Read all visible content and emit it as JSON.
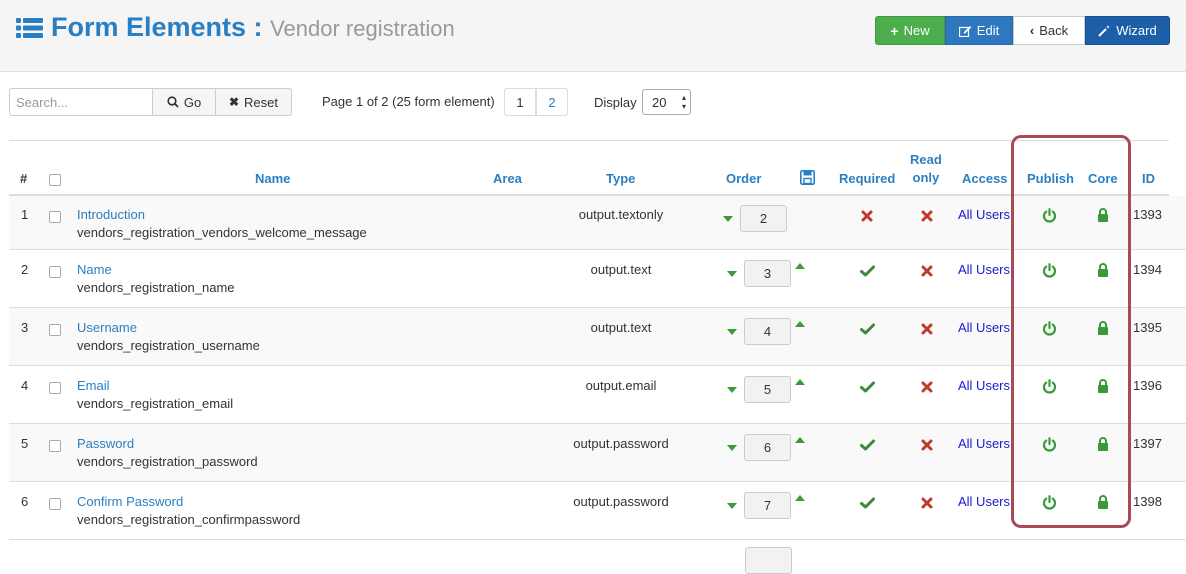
{
  "header": {
    "title": "Form Elements :",
    "subtitle": "Vendor registration",
    "icon": "list-icon"
  },
  "toolbar": {
    "new_label": "New",
    "edit_label": "Edit",
    "back_label": "Back",
    "wizard_label": "Wizard"
  },
  "filter": {
    "search_placeholder": "Search...",
    "go_label": "Go",
    "reset_label": "Reset",
    "page_info": "Page 1 of 2 (25 form element)",
    "pages": [
      "1",
      "2"
    ],
    "display_label": "Display",
    "display_value": "20"
  },
  "columns": {
    "hash": "#",
    "name": "Name",
    "area": "Area",
    "type": "Type",
    "order": "Order",
    "required": "Required",
    "read_only_1": "Read",
    "read_only_2": "only",
    "access": "Access",
    "publish": "Publish",
    "core": "Core",
    "id": "ID"
  },
  "rows": [
    {
      "num": "1",
      "label": "Introduction",
      "name": "vendors_registration_vendors_welcome_message",
      "type": "output.textonly",
      "order": "2",
      "access": "All Users",
      "id": "1393",
      "required": false,
      "read_only": false
    },
    {
      "num": "2",
      "label": "Name",
      "name": "vendors_registration_name",
      "type": "output.text",
      "order": "3",
      "access": "All Users",
      "id": "1394",
      "required": true,
      "read_only": false
    },
    {
      "num": "3",
      "label": "Username",
      "name": "vendors_registration_username",
      "type": "output.text",
      "order": "4",
      "access": "All Users",
      "id": "1395",
      "required": true,
      "read_only": false
    },
    {
      "num": "4",
      "label": "Email",
      "name": "vendors_registration_email",
      "type": "output.email",
      "order": "5",
      "access": "All Users",
      "id": "1396",
      "required": true,
      "read_only": false
    },
    {
      "num": "5",
      "label": "Password",
      "name": "vendors_registration_password",
      "type": "output.password",
      "order": "6",
      "access": "All Users",
      "id": "1397",
      "required": true,
      "read_only": false
    },
    {
      "num": "6",
      "label": "Confirm Password",
      "name": "vendors_registration_confirmpassword",
      "type": "output.password",
      "order": "7",
      "access": "All Users",
      "id": "1398",
      "required": true,
      "read_only": false
    }
  ],
  "colors": {
    "accent": "#2a7fc2",
    "success": "#4cae4c",
    "danger": "#c0392b",
    "highlight": "#a94a5a"
  }
}
